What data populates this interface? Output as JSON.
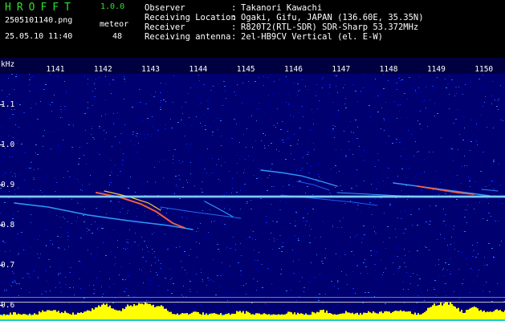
{
  "header": {
    "app_title": "HROFFT",
    "app_version": "1.0.0",
    "file_name": "2505101140.png",
    "datetime": "25.05.10 11:40",
    "meteor_label": "meteor",
    "meteor_count": "48",
    "info": [
      {
        "label": "Observer",
        "value": "Takanori Kawachi"
      },
      {
        "label": "Receiving Location",
        "value": "Ogaki, Gifu, JAPAN (136.60E, 35.35N)"
      },
      {
        "label": "Receiver",
        "value": "R820T2(RTL-SDR) SDR-Sharp 53.372MHz"
      },
      {
        "label": "Receiving antenna",
        "value": "2el-HB9CV Vertical (el. E-W)"
      }
    ]
  },
  "spectrogram": {
    "y_unit": "kHz",
    "x_ticks": [
      "1141",
      "1142",
      "1143",
      "1144",
      "1145",
      "1146",
      "1147",
      "1148",
      "1149",
      "1150"
    ],
    "y_ticks": [
      "1.1",
      "1.0",
      "0.9",
      "0.8",
      "0.7",
      "0.6"
    ],
    "carrier_khz": 0.87,
    "background_color": "#000070",
    "carrier_color": "#40c0ff",
    "trail_color": "#30a0ff",
    "hot_color": "#ff6040",
    "bar_color": "#ffff00",
    "baseline_color": "#20c8e0"
  }
}
